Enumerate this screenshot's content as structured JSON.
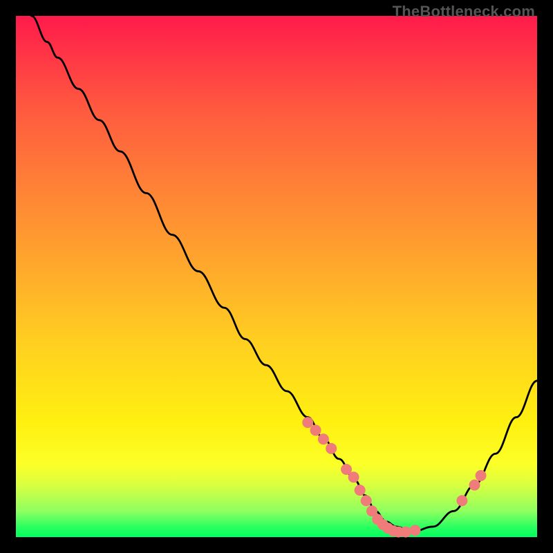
{
  "watermark": "TheBottleneck.com",
  "chart_data": {
    "type": "line",
    "title": "",
    "xlabel": "",
    "ylabel": "",
    "xlim": [
      0,
      100
    ],
    "ylim": [
      0,
      100
    ],
    "series": [
      {
        "name": "bottleneck-curve",
        "x": [
          3,
          6,
          8,
          12,
          16,
          20,
          25,
          30,
          35,
          40,
          44,
          48,
          52,
          56,
          59,
          62,
          65,
          67,
          69,
          71,
          73,
          76,
          80,
          84,
          88,
          92,
          96,
          100
        ],
        "values": [
          100,
          95,
          92,
          86,
          80,
          74,
          66,
          58,
          51,
          44,
          38,
          33,
          28,
          23,
          19,
          15,
          11,
          8,
          5,
          3,
          2,
          1,
          2,
          5,
          10,
          16,
          23,
          30
        ]
      }
    ],
    "markers": {
      "name": "highlighted-points",
      "x": [
        56,
        57.5,
        59,
        60.5,
        63.4,
        64.8,
        66,
        67.2,
        68.3,
        69.4,
        70.4,
        71.4,
        72.4,
        73.4,
        74.8,
        76.6,
        85.6,
        88,
        89.2
      ],
      "values": [
        22,
        20.5,
        18.8,
        17,
        13,
        11.5,
        9,
        7,
        5,
        3.4,
        2.4,
        1.7,
        1.2,
        1,
        1,
        1.3,
        7,
        10,
        11.8
      ],
      "color": "#ef7b7b",
      "radius": 8
    }
  }
}
